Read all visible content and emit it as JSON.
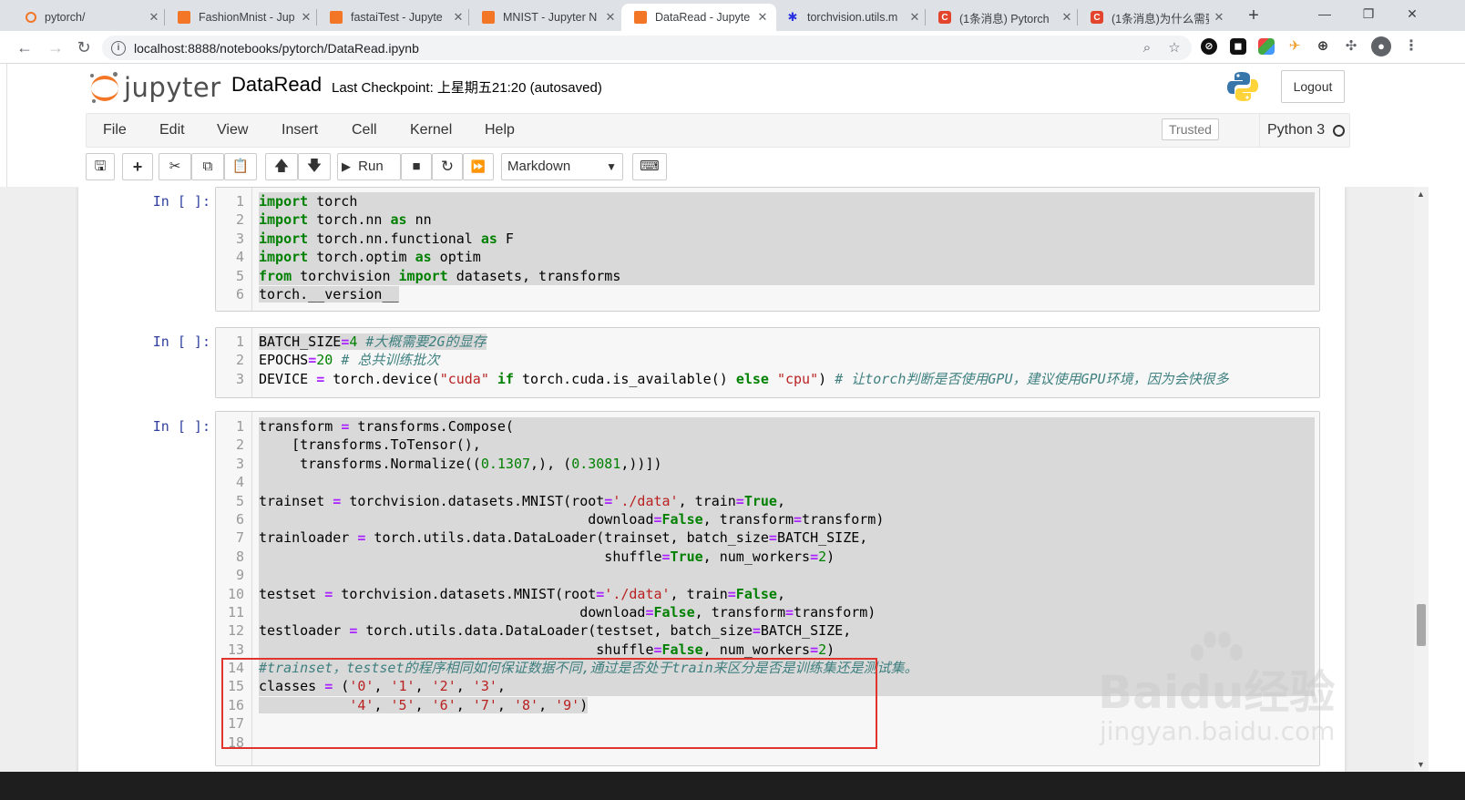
{
  "browser": {
    "tabs": [
      {
        "title": "pytorch/",
        "favicon": "jupyter-icon",
        "active": false
      },
      {
        "title": "FashionMnist - Jup",
        "favicon": "notebook-icon",
        "active": false
      },
      {
        "title": "fastaiTest - Jupyte",
        "favicon": "notebook-icon",
        "active": false
      },
      {
        "title": "MNIST - Jupyter N",
        "favicon": "notebook-icon",
        "active": false
      },
      {
        "title": "DataRead - Jupyte",
        "favicon": "notebook-icon",
        "active": true
      },
      {
        "title": "torchvision.utils.m",
        "favicon": "baidu-paw-icon",
        "active": false
      },
      {
        "title": "(1条消息) Pytorch",
        "favicon": "csdn-icon",
        "active": false
      },
      {
        "title": "(1条消息)为什么需要",
        "favicon": "csdn-icon",
        "active": false
      }
    ],
    "url": "localhost:8888/notebooks/pytorch/DataRead.ipynb"
  },
  "jupyter": {
    "logo_text": "jupyter",
    "notebook_name": "DataRead",
    "checkpoint": "Last Checkpoint: 上星期五21:20   (autosaved)",
    "logout_label": "Logout",
    "menu": [
      "File",
      "Edit",
      "View",
      "Insert",
      "Cell",
      "Kernel",
      "Help"
    ],
    "trusted_label": "Trusted",
    "kernel_name": "Python 3",
    "run_label": "Run",
    "cell_type": "Markdown"
  },
  "cells": [
    {
      "prompt": "In [ ]:",
      "lines": [
        "import torch",
        "import torch.nn as nn",
        "import torch.nn.functional as F",
        "import torch.optim as optim",
        "from torchvision import datasets, transforms",
        "torch.__version__"
      ]
    },
    {
      "prompt": "In [ ]:",
      "lines": [
        "BATCH_SIZE=4 #大概需要2G的显存",
        "EPOCHS=20 # 总共训练批次",
        "DEVICE = torch.device(\"cuda\" if torch.cuda.is_available() else \"cpu\") # 让torch判断是否使用GPU，建议使用GPU环境，因为会快很多"
      ]
    },
    {
      "prompt": "In [ ]:",
      "lines": [
        "transform = transforms.Compose(",
        "    [transforms.ToTensor(),",
        "     transforms.Normalize((0.1307,), (0.3081,))])",
        "",
        "trainset = torchvision.datasets.MNIST(root='./data', train=True,",
        "                                        download=False, transform=transform)",
        "trainloader = torch.utils.data.DataLoader(trainset, batch_size=BATCH_SIZE,",
        "                                          shuffle=True, num_workers=2)",
        "",
        "testset = torchvision.datasets.MNIST(root='./data', train=False,",
        "                                       download=False, transform=transform)",
        "testloader = torch.utils.data.DataLoader(testset, batch_size=BATCH_SIZE,",
        "                                         shuffle=False, num_workers=2)",
        "#trainset，testset的程序相同如何保证数据不同,通过是否处于train来区分是否是训练集还是测试集。",
        "classes = ('0', '1', '2', '3',",
        "           '4', '5', '6', '7', '8', '9')",
        "",
        ""
      ]
    }
  ],
  "watermark": {
    "brand": "Baidu经验",
    "url": "jingyan.baidu.com"
  },
  "colors": {
    "jupyter_orange": "#f37726",
    "highlight_box": "#e0342d",
    "selection": "#d9d9d9"
  }
}
